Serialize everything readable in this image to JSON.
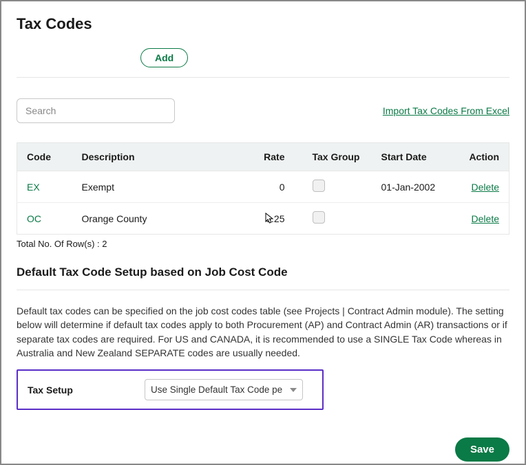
{
  "page_title": "Tax Codes",
  "add_button_label": "Add",
  "search_placeholder": "Search",
  "import_link_label": "Import Tax Codes From Excel",
  "table": {
    "headers": {
      "code": "Code",
      "description": "Description",
      "rate": "Rate",
      "tax_group": "Tax Group",
      "start_date": "Start Date",
      "action": "Action"
    },
    "rows": [
      {
        "code": "EX",
        "description": "Exempt",
        "rate": "0",
        "tax_group": false,
        "start_date": "01-Jan-2002",
        "action_label": "Delete"
      },
      {
        "code": "OC",
        "description": "Orange County",
        "rate": "9.25",
        "tax_group": false,
        "start_date": "",
        "action_label": "Delete"
      }
    ]
  },
  "total_rows_label": "Total No. Of Row(s) : 2",
  "default_section_title": "Default Tax Code Setup based on Job Cost Code",
  "default_section_desc": "Default tax codes can be specified on the job cost codes table (see Projects | Contract Admin module). The setting below will determine if default tax codes apply to both Procurement (AP) and Contract Admin (AR) transactions or if separate tax codes are required. For US and CANADA, it is recommended to use a SINGLE Tax Code whereas in Australia and New Zealand SEPARATE codes are usually needed.",
  "tax_setup_label": "Tax Setup",
  "tax_setup_selected": "Use Single Default Tax Code pe",
  "save_button_label": "Save"
}
